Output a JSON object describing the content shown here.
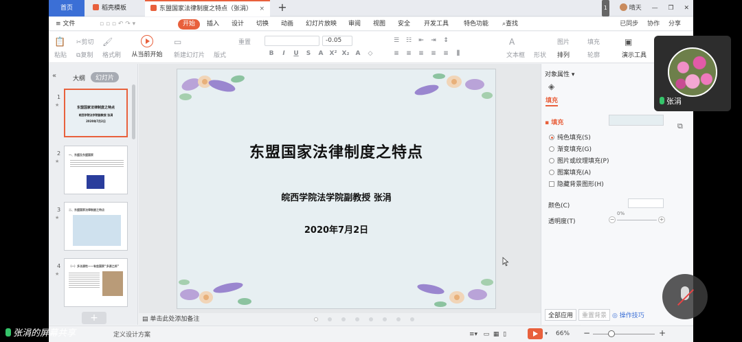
{
  "tabs": {
    "home": "首页",
    "template": "稻壳模板",
    "document": "东盟国家法律制度之特点（张涓）",
    "close": "×",
    "add": "+"
  },
  "window": {
    "badge": "1",
    "weather": "晴天",
    "minimize": "—",
    "restore": "❐",
    "close": "✕"
  },
  "menu": {
    "file": "≡ 文件",
    "start": "开始",
    "items": [
      "插入",
      "设计",
      "切换",
      "动画",
      "幻灯片放映",
      "审阅",
      "视图",
      "安全",
      "开发工具",
      "特色功能"
    ],
    "search": "查找",
    "sync": "已同步",
    "collab": "协作",
    "share": "分享"
  },
  "ribbon": {
    "paste": "粘贴",
    "cut": "剪切",
    "copy": "复制",
    "format_painter": "格式刷",
    "play_from_current": "从当前开始",
    "new_slide": "新建幻灯片",
    "layout": "版式",
    "reset": "重置",
    "font_size": "-0.05",
    "textbox": "文本框",
    "shape": "形状",
    "arrange": "排列",
    "picture": "图片",
    "fill": "填充",
    "outline": "轮廓",
    "presentation_tools": "演示工具"
  },
  "left_panel": {
    "outline_tab": "大纲",
    "slides_tab": "幻灯片",
    "add": "+",
    "thumbs": [
      {
        "num": "1",
        "title": "东盟国家法律制度之特点",
        "line2": "皖西学院法学院副教授  张涓",
        "line3": "2020年7月2日"
      },
      {
        "num": "2",
        "title": "一、东盟及东盟国家"
      },
      {
        "num": "3",
        "title": "二、东盟国家法律制度之特点"
      },
      {
        "num": "4",
        "title": "（一）多法源性——有些国家“多源之邦”"
      }
    ]
  },
  "slide": {
    "title": "东盟国家法律制度之特点",
    "subtitle": "皖西学院法学院副教授    张涓",
    "date": "2020年7月2日"
  },
  "notes": {
    "placeholder": "单击此处添加备注"
  },
  "right_panel": {
    "title": "对象属性 ▾",
    "fill_tab": "填充",
    "fill_header": "▪ 填充",
    "options": [
      "纯色填充(S)",
      "渐变填充(G)",
      "图片或纹理填充(P)",
      "图案填充(A)"
    ],
    "hide_bg": "隐藏背景图形(H)",
    "color_label": "颜色(C)",
    "transparency_label": "透明度(T)",
    "transparency_value": "0%",
    "apply_all": "全部应用",
    "reset_bg": "重置背景",
    "tips": "操作技巧"
  },
  "status": {
    "left": "定义设计方案",
    "zoom": "66%"
  },
  "overlay": {
    "cam_name": "张涓",
    "share_label": "张涓的屏幕共享"
  },
  "colors": {
    "accent": "#e8603c",
    "home_tab": "#3b6fd6",
    "slide_bg": "#e7eff2"
  }
}
